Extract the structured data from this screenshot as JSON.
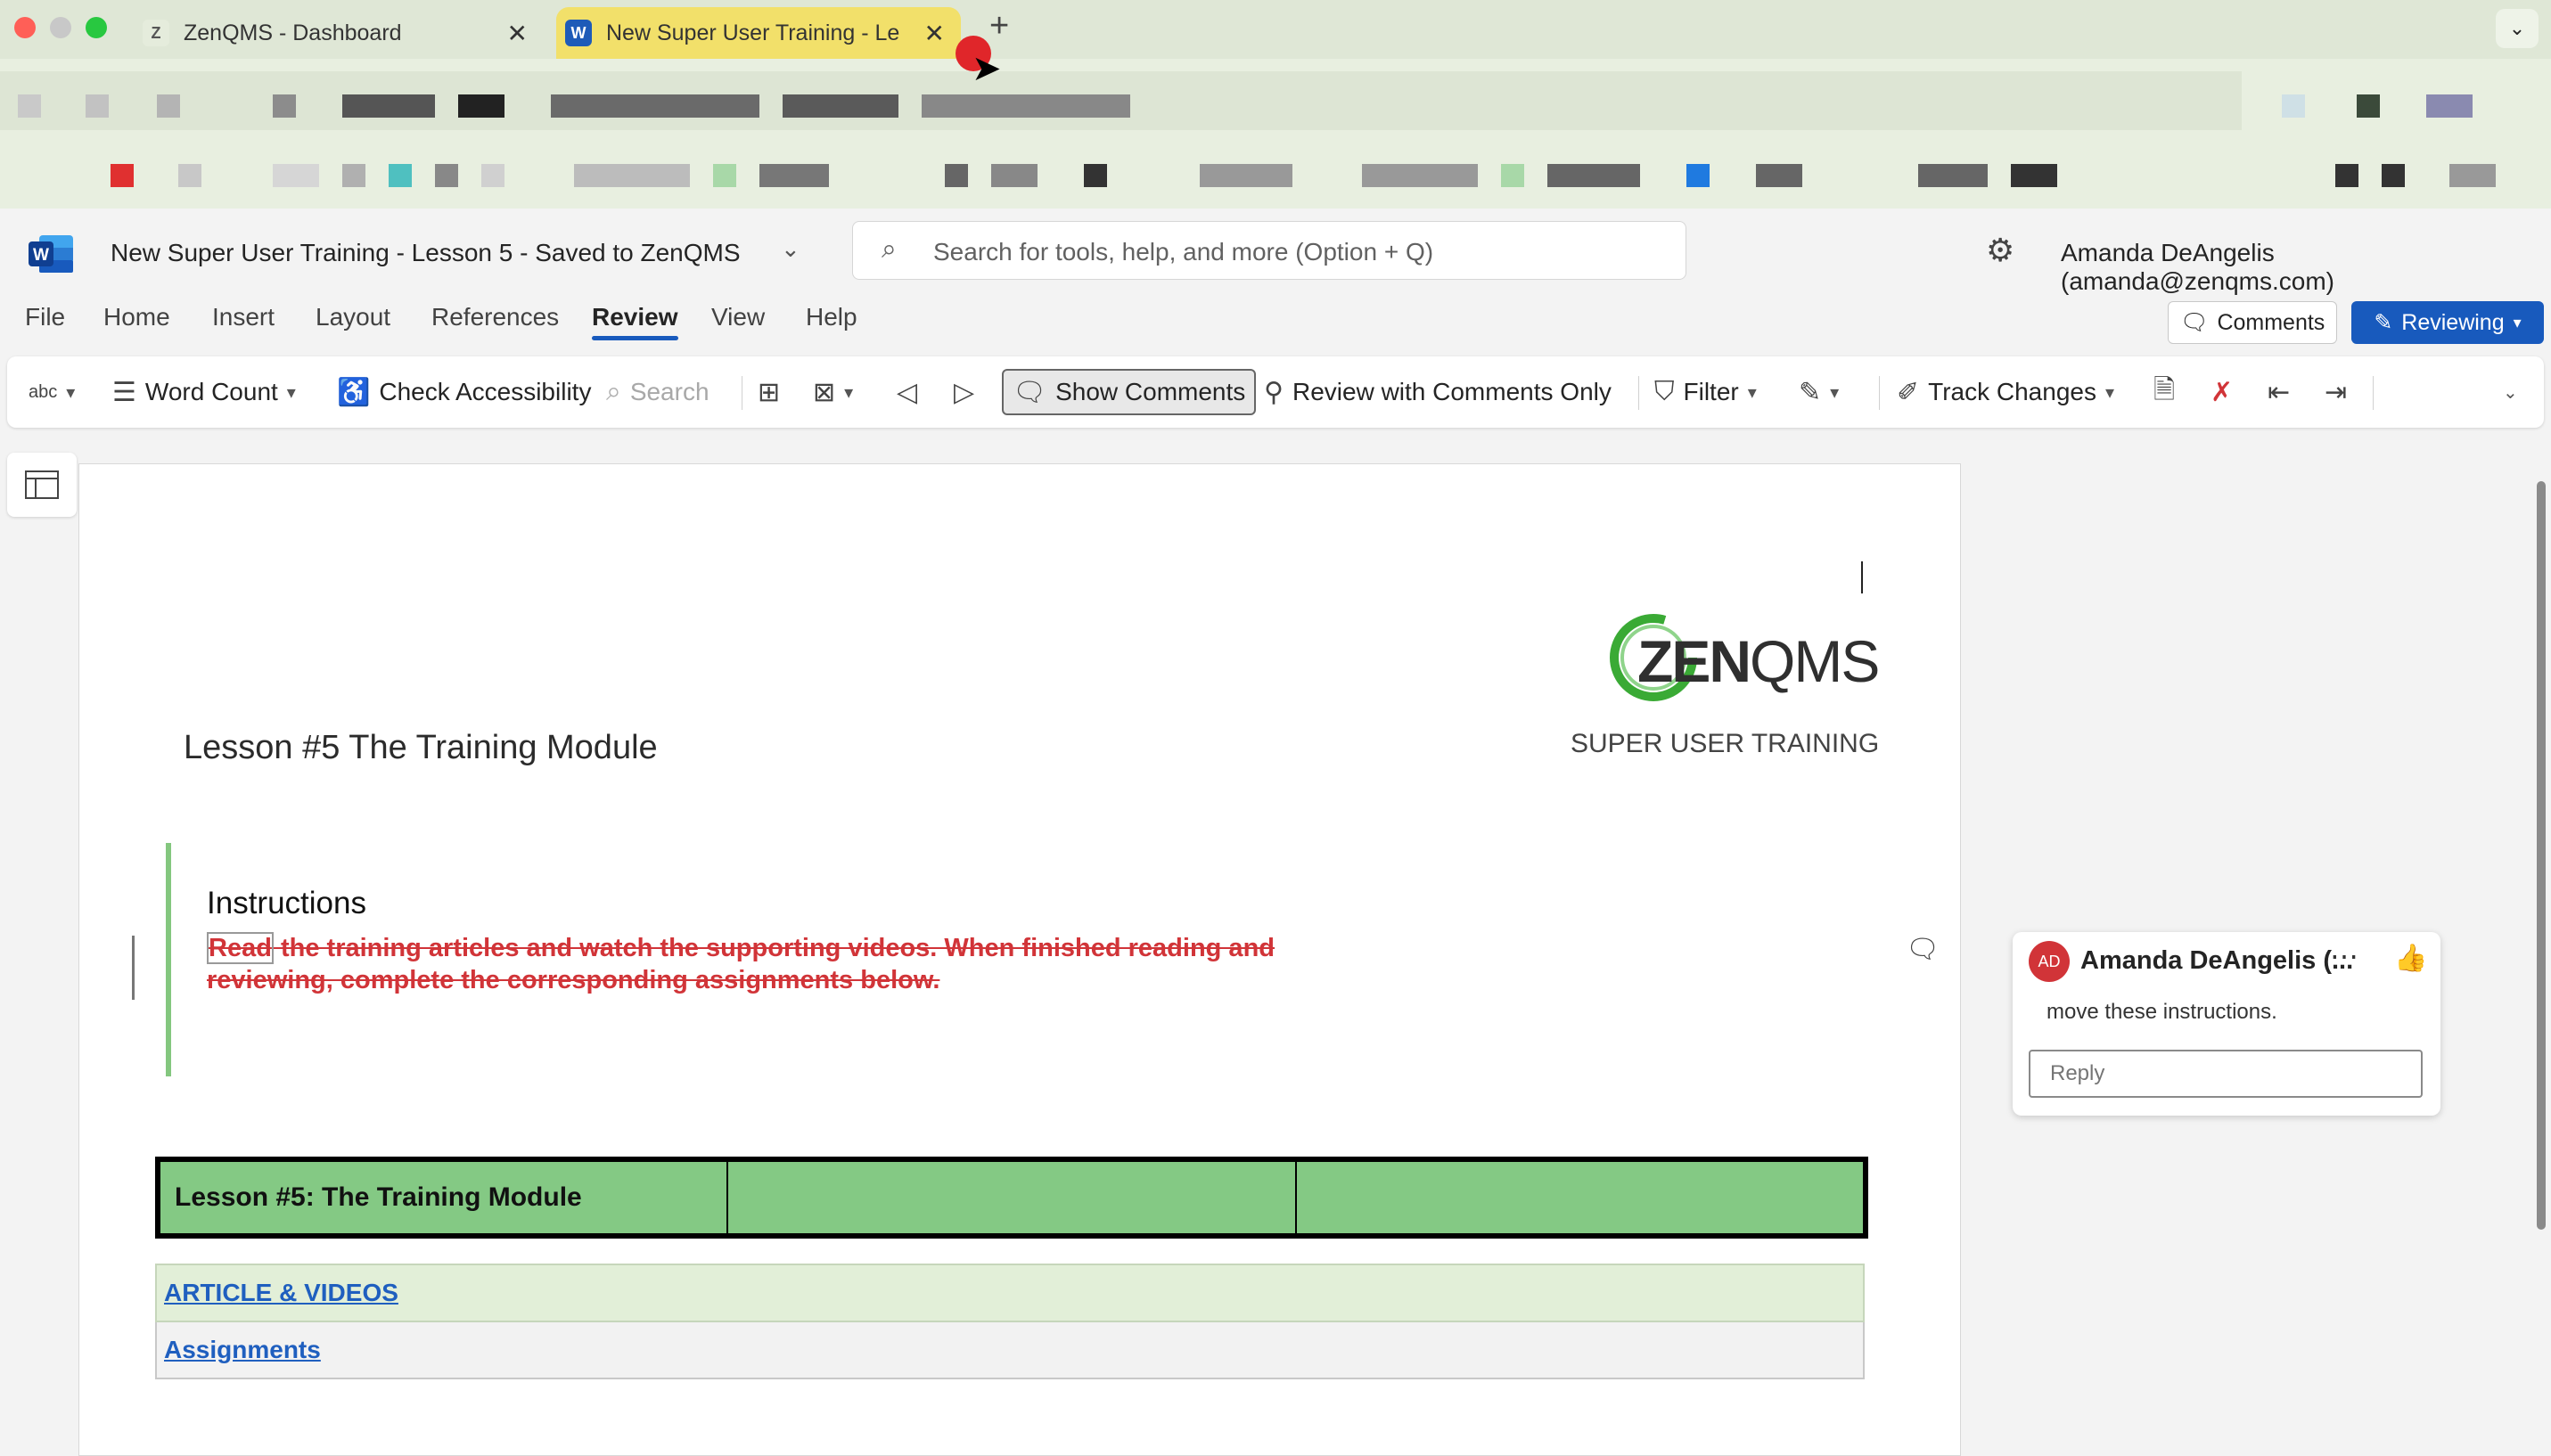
{
  "browser": {
    "tabs": [
      {
        "title": "ZenQMS - Dashboard",
        "favicon": "Z"
      },
      {
        "title": "New Super User Training - Le",
        "favicon": "W"
      }
    ],
    "new_tab": "+",
    "tab_menu": "⌄"
  },
  "word": {
    "doc_title": "New Super User Training - Lesson 5  -  Saved to ZenQMS",
    "search_placeholder": "Search for tools, help, and more (Option + Q)",
    "user": "Amanda DeAngelis (amanda@zenqms.com)",
    "menus": [
      "File",
      "Home",
      "Insert",
      "Layout",
      "References",
      "Review",
      "View",
      "Help"
    ],
    "active_menu": "Review",
    "comments_button": "Comments",
    "reviewing_button": "Reviewing",
    "ribbon": {
      "spelling": "abc",
      "word_count": "Word Count",
      "check_accessibility": "Check Accessibility",
      "search": "Search",
      "show_comments": "Show Comments",
      "review_with_comments_only": "Review with Comments Only",
      "filter": "Filter",
      "track_changes": "Track Changes"
    }
  },
  "document": {
    "logo_zen": "ZEN",
    "logo_qms": "QMS",
    "super_user": "SUPER USER TRAINING",
    "lesson_title": "Lesson #5 The Training Module",
    "instructions_heading": "Instructions",
    "deleted_first_word": "Read",
    "deleted_rest": " the training articles and watch the supporting videos. When finished reading and reviewing, complete the corresponding assignments below.",
    "table_header": [
      "Lesson #5: The Training Module",
      "",
      ""
    ],
    "link_articles": "ARTICLE & VIDEOS",
    "link_assignments": "Assignments"
  },
  "comment": {
    "initials": "AD",
    "author": "Amanda DeAngelis (...",
    "text": "move these instructions.",
    "reply_placeholder": "Reply"
  },
  "colors": {
    "word_blue": "#185abd",
    "deletion_red": "#d13438",
    "table_green": "#84c984",
    "zen_green": "#3aaa35"
  }
}
